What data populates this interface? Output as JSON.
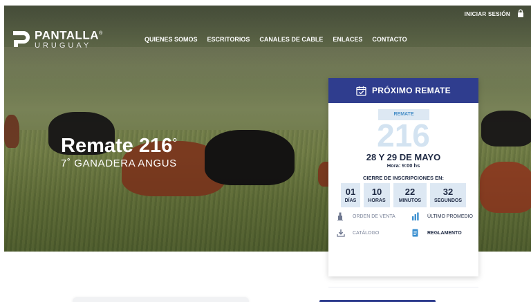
{
  "brand": {
    "name": "PANTALLA",
    "registered": "®",
    "tagline": "URUGUAY"
  },
  "topbar": {
    "login_label": "INICIAR SESIÓN",
    "lock_icon": "lock-icon"
  },
  "nav": {
    "items": [
      {
        "label": "QUIENES SOMOS"
      },
      {
        "label": "ESCRITORIOS"
      },
      {
        "label": "CANALES DE CABLE"
      },
      {
        "label": "ENLACES"
      },
      {
        "label": "CONTACTO"
      }
    ]
  },
  "hero": {
    "title": "Remate 216",
    "title_degree": "°",
    "subtitle": "7˚ GANADERA ANGUS"
  },
  "auction_card": {
    "header": "PRÓXIMO REMATE",
    "header_icon": "calendar-check-icon",
    "badge": "REMATE",
    "number": "216",
    "date": "28 Y 29 DE MAYO",
    "time": "Hora: 9:00 hs",
    "countdown_title": "CIERRE DE INSCRIPCIONES EN:",
    "countdown": [
      {
        "value": "01",
        "unit": "DÍAS"
      },
      {
        "value": "10",
        "unit": "HORAS"
      },
      {
        "value": "22",
        "unit": "MINUTOS"
      },
      {
        "value": "32",
        "unit": "SEGUNDOS"
      }
    ],
    "links": [
      {
        "label": "ORDEN DE VENTA",
        "icon": "gavel-icon"
      },
      {
        "label": "ÚLTIMO PROMEDIO",
        "icon": "bar-chart-icon"
      },
      {
        "label": "CATÁLOGO",
        "icon": "download-icon"
      },
      {
        "label": "REGLAMENTO",
        "icon": "document-icon"
      }
    ]
  },
  "colors": {
    "brand_blue": "#2f3d8e",
    "light_blue": "#dde8f3",
    "accent_text": "#4a90c8",
    "dark_text": "#1f2a44"
  }
}
